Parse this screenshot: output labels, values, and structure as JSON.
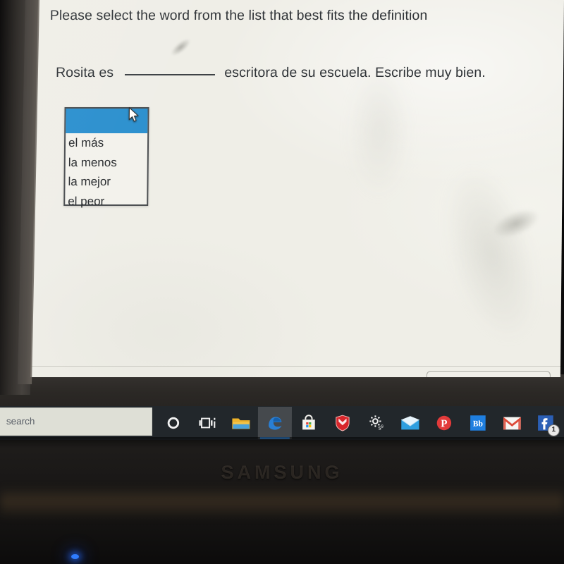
{
  "device": {
    "brand_text": "SAMSUNG",
    "power_led_color": "#2f7cff"
  },
  "quiz": {
    "prompt": "Please select the word from the list that best fits the definition",
    "sentence_before_blank": "Rosita es",
    "sentence_after_blank": "escritora de su escuela. Escribe muy bien.",
    "blank_placeholder": ""
  },
  "dropdown": {
    "name": "word-choice-listbox",
    "selected_value": "",
    "highlight_color": "#2a8fce",
    "options": [
      {
        "label": "",
        "selected": true
      },
      {
        "label": "el más",
        "selected": false
      },
      {
        "label": "la menos",
        "selected": false
      },
      {
        "label": "la mejor",
        "selected": false
      },
      {
        "label": "el peor",
        "selected": false
      }
    ]
  },
  "page_buttons": {
    "secondary_label": "",
    "primary_label": "",
    "primary_color": "#36a6d6"
  },
  "taskbar": {
    "search_text": "search",
    "active_app": "Microsoft Edge",
    "accent_color": "#3b8fe0",
    "items": [
      {
        "name": "cortana-icon",
        "label": "Cortana",
        "active": false,
        "badge": ""
      },
      {
        "name": "task-view-icon",
        "label": "Task View",
        "active": false,
        "badge": ""
      },
      {
        "name": "file-explorer-icon",
        "label": "File Explorer",
        "active": false,
        "badge": ""
      },
      {
        "name": "edge-icon",
        "label": "Microsoft Edge",
        "active": true,
        "badge": ""
      },
      {
        "name": "microsoft-store-icon",
        "label": "Microsoft Store",
        "active": false,
        "badge": ""
      },
      {
        "name": "mcafee-icon",
        "label": "McAfee",
        "active": false,
        "badge": ""
      },
      {
        "name": "settings-gear-icon",
        "label": "Settings",
        "active": false,
        "badge": ""
      },
      {
        "name": "mail-icon",
        "label": "Mail",
        "active": false,
        "badge": ""
      },
      {
        "name": "pinterest-icon",
        "label": "Pinterest",
        "active": false,
        "badge": ""
      },
      {
        "name": "blackboard-icon",
        "label": "Bb",
        "active": false,
        "badge": ""
      },
      {
        "name": "gmail-icon",
        "label": "Gmail",
        "active": false,
        "badge": ""
      },
      {
        "name": "facebook-icon",
        "label": "Facebook",
        "active": false,
        "badge": "1"
      },
      {
        "name": "app-icon-edge-right",
        "label": "",
        "active": false,
        "badge": ""
      }
    ]
  }
}
